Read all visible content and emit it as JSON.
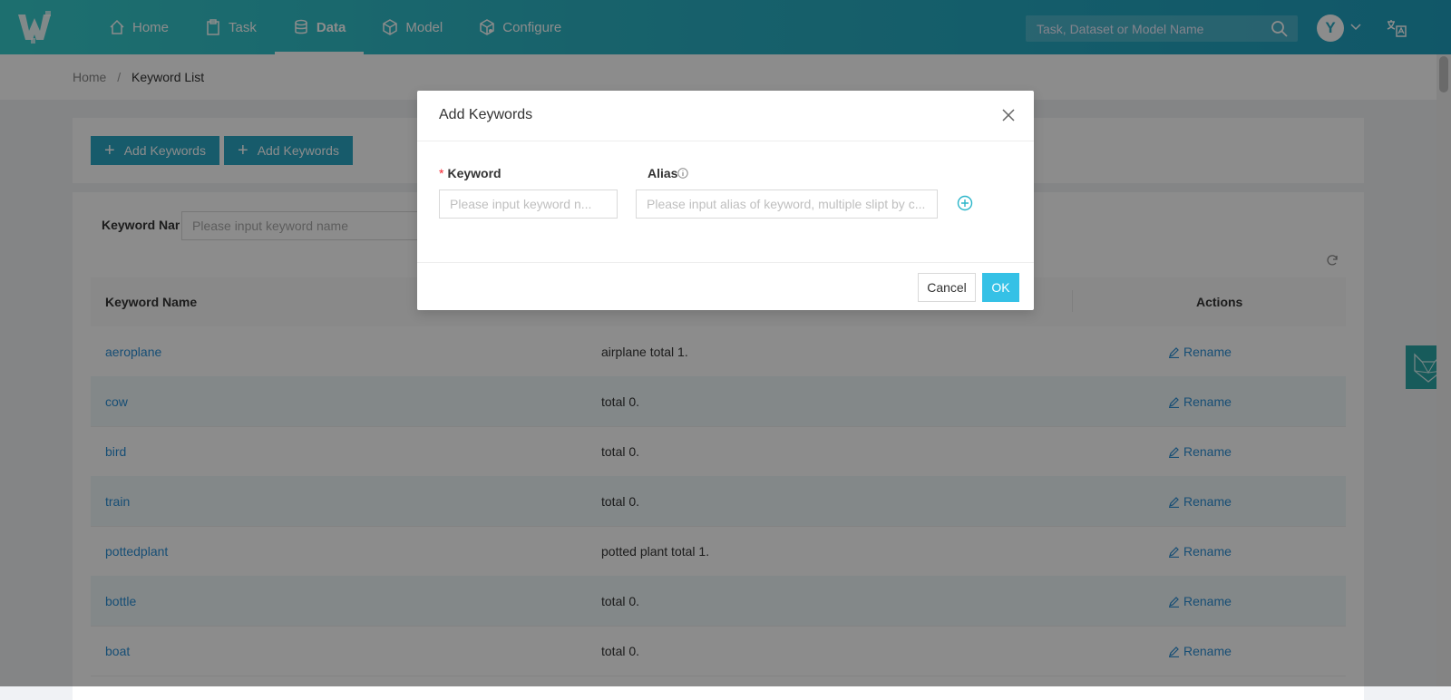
{
  "header": {
    "nav": [
      {
        "label": "Home",
        "icon": "home-icon"
      },
      {
        "label": "Task",
        "icon": "clipboard-icon"
      },
      {
        "label": "Data",
        "icon": "database-icon",
        "active": true
      },
      {
        "label": "Model",
        "icon": "cube-icon"
      },
      {
        "label": "Configure",
        "icon": "cube-settings-icon"
      }
    ],
    "search_placeholder": "Task, Dataset or Model Name",
    "avatar_initial": "Y"
  },
  "breadcrumb": {
    "home": "Home",
    "separator": "/",
    "current": "Keyword List"
  },
  "toolbar": {
    "add_button_1": "Add Keywords",
    "add_button_2": "Add Keywords"
  },
  "filter": {
    "label": "Keyword Name",
    "placeholder": "Please input keyword name"
  },
  "table": {
    "columns": {
      "name": "Keyword Name",
      "actions": "Actions"
    },
    "rows": [
      {
        "name": "aeroplane",
        "alias": "airplane total 1.",
        "action": "Rename"
      },
      {
        "name": "cow",
        "alias": "total 0.",
        "action": "Rename"
      },
      {
        "name": "bird",
        "alias": "total 0.",
        "action": "Rename"
      },
      {
        "name": "train",
        "alias": "total 0.",
        "action": "Rename"
      },
      {
        "name": "pottedplant",
        "alias": "potted plant total 1.",
        "action": "Rename"
      },
      {
        "name": "bottle",
        "alias": "total 0.",
        "action": "Rename"
      },
      {
        "name": "boat",
        "alias": "total 0.",
        "action": "Rename"
      }
    ]
  },
  "modal": {
    "title": "Add Keywords",
    "keyword_label": "Keyword",
    "keyword_required_mark": "*",
    "keyword_placeholder": "Please input keyword n...",
    "alias_label": "Alias",
    "alias_placeholder": "Please input alias of keyword, multiple slipt by c...",
    "cancel_label": "Cancel",
    "ok_label": "OK"
  },
  "colors": {
    "accent": "#2aa6c4",
    "link": "#2a8fd6",
    "ok_button": "#35c1e6"
  }
}
